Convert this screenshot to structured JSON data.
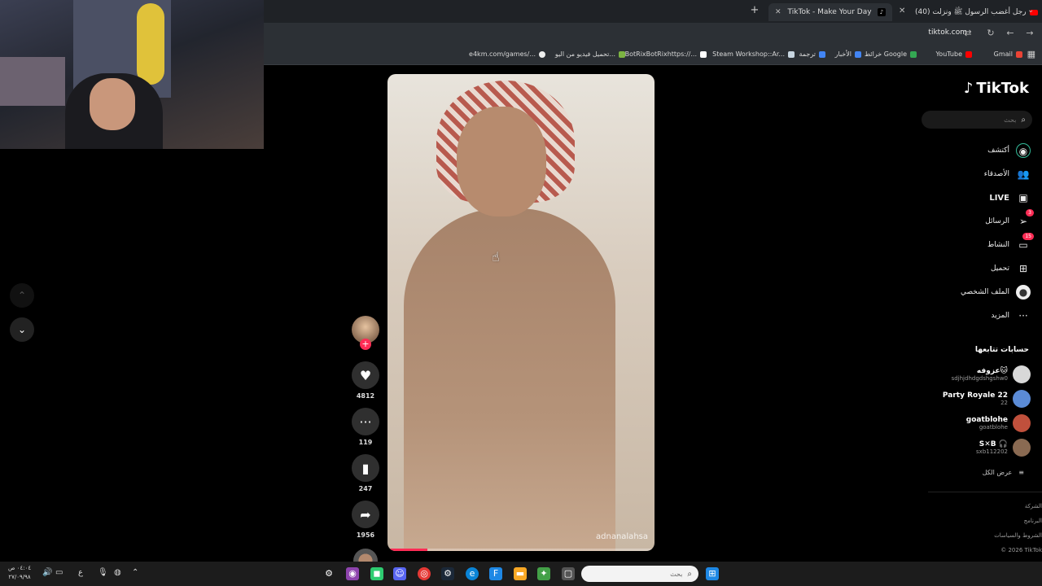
{
  "browser": {
    "tabs": [
      {
        "label": "TikTok - Make Your Day",
        "active": true
      },
      {
        "label": "(40) رجل أغضب الرسول ﷺ ونزلت",
        "active": false
      }
    ],
    "new_tab": "+",
    "url": "tiktok.com",
    "bookmarks": [
      {
        "label": "Gmail",
        "color": "#ea4335"
      },
      {
        "label": "YouTube",
        "color": "#ff0000"
      },
      {
        "label": "خرائط Google",
        "color": "#34a853"
      },
      {
        "label": "الأخبار",
        "color": "#4285f4"
      },
      {
        "label": "ترجمة",
        "color": "#4285f4"
      },
      {
        "label": "Steam Workshop::Ar...",
        "color": "#1b2838"
      },
      {
        "label": "BotRixBotRixhttps://...",
        "color": "#ffffff"
      },
      {
        "label": "تحميل فيديو من اليو...",
        "color": "#2e7d32"
      },
      {
        "label": "e4km.com/games/...",
        "color": "#ffffff"
      }
    ]
  },
  "video": {
    "handle": "adnanalahsa",
    "progress": 0.15
  },
  "actions": {
    "likes": "4812",
    "comments": "119",
    "saves": "247",
    "shares": "1956"
  },
  "sidebar": {
    "logo": "TikTok",
    "search_placeholder": "بحث",
    "nav": [
      {
        "label": "أكتشف",
        "icon": "compass-icon"
      },
      {
        "label": "الأصدقاء",
        "icon": "friends-icon"
      },
      {
        "label": "LIVE",
        "icon": "live-icon"
      },
      {
        "label": "الرسائل",
        "icon": "messages-icon",
        "badge": "3"
      },
      {
        "label": "النشاط",
        "icon": "activity-icon",
        "badge": "15"
      },
      {
        "label": "تحميل",
        "icon": "upload-icon"
      },
      {
        "label": "الملف الشخصي",
        "icon": "profile-icon"
      },
      {
        "label": "المزيد",
        "icon": "more-icon"
      }
    ],
    "following_title": "حسابات تتابعها",
    "following": [
      {
        "name": "عزوفه🐱",
        "handle": "sdjhjdhdgdshgshw0",
        "color": "#d8d8d8"
      },
      {
        "name": "Party Royale 22",
        "handle": "22",
        "color": "#5b8bd6"
      },
      {
        "name": "goatblohe",
        "handle": "goatblohe",
        "color": "#c0503c"
      },
      {
        "name": "S✕B 🎧",
        "handle": "sxb112202",
        "color": "#8a6a52"
      }
    ],
    "see_all": "عرض الكل",
    "footer": [
      "الشركة",
      "البرنامج",
      "الشروط والسياسات",
      "© 2026 TikTok"
    ]
  },
  "taskbar": {
    "search_placeholder": "بحث",
    "clock_time": "٠٤:٠٤ ص",
    "clock_date": "٢٧/٠٩/٩٨",
    "lang": "ع"
  }
}
